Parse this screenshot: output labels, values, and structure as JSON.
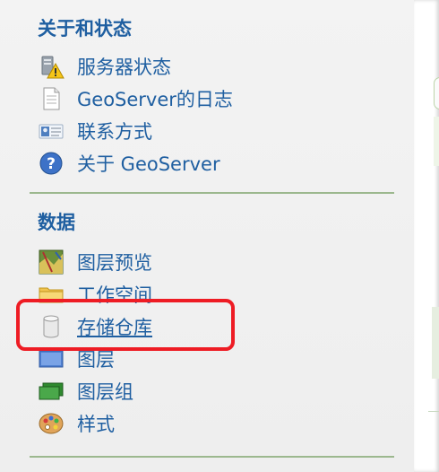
{
  "sidebar": {
    "about_section": {
      "title": "关于和状态",
      "items": [
        {
          "label": "服务器状态",
          "icon": "server-status-icon"
        },
        {
          "label": "GeoServer的日志",
          "icon": "log-file-icon"
        },
        {
          "label": "联系方式",
          "icon": "contact-card-icon"
        },
        {
          "label": "关于 GeoServer",
          "icon": "help-icon"
        }
      ]
    },
    "data_section": {
      "title": "数据",
      "items": [
        {
          "label": "图层预览",
          "icon": "layer-preview-icon"
        },
        {
          "label": "工作空间",
          "icon": "folder-icon"
        },
        {
          "label": "存储仓库",
          "icon": "database-icon",
          "active": true
        },
        {
          "label": "图层",
          "icon": "layer-icon"
        },
        {
          "label": "图层组",
          "icon": "layer-group-icon"
        },
        {
          "label": "样式",
          "icon": "palette-icon"
        }
      ]
    }
  },
  "colors": {
    "link": "#1f5fa1",
    "divider": "#9cb88e",
    "highlight": "#ee1c24"
  }
}
